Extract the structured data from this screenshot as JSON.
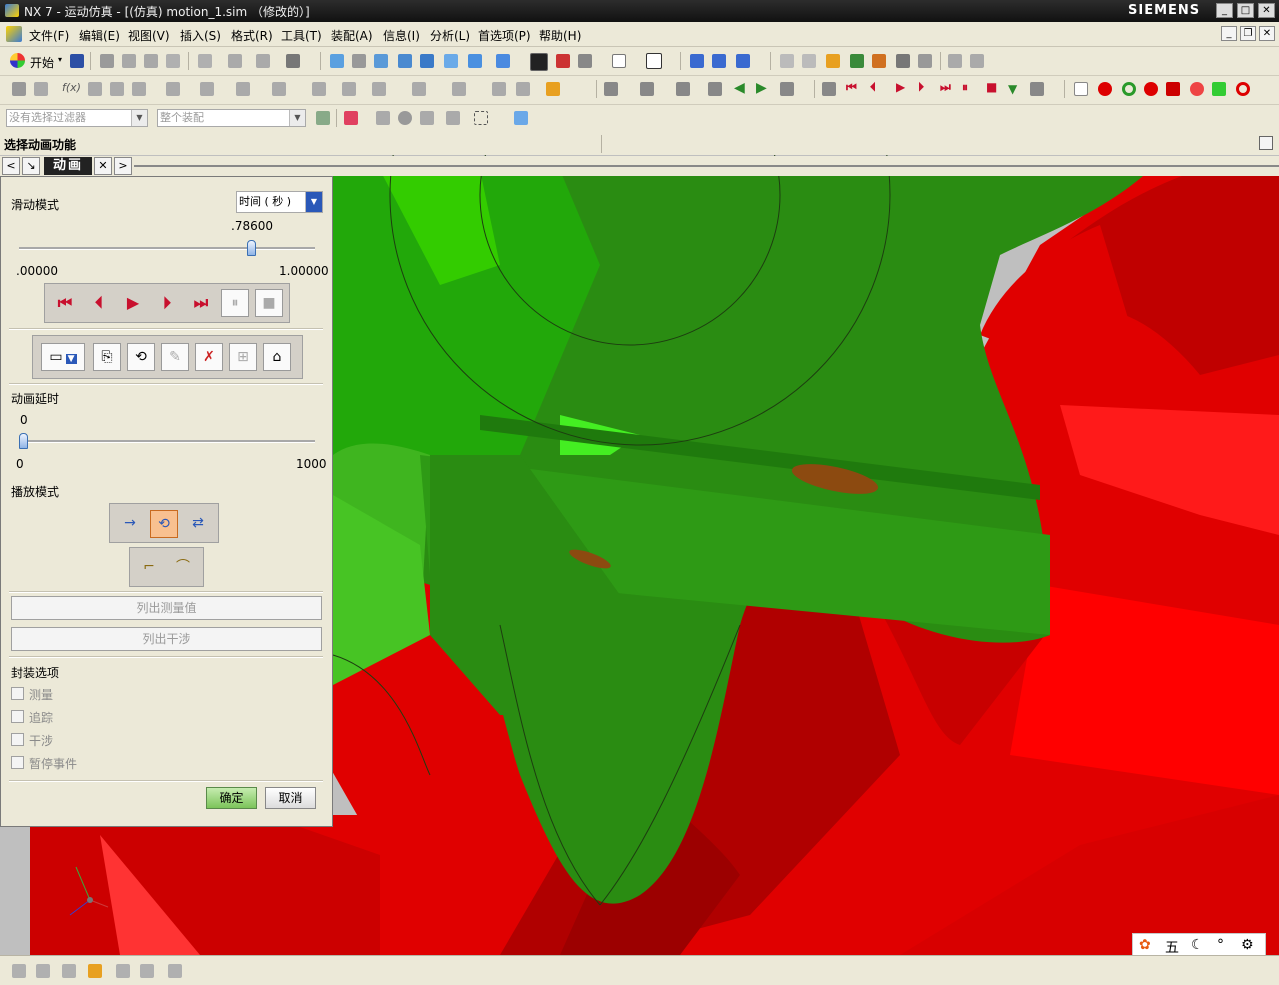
{
  "window": {
    "title": "NX 7 - 运动仿真 - [(仿真) motion_1.sim （修改的）]",
    "brand": "SIEMENS",
    "controls": [
      "_",
      "□",
      "✕"
    ]
  },
  "menubar": {
    "items": [
      "文件(F)",
      "编辑(E)",
      "视图(V)",
      "插入(S)",
      "格式(R)",
      "工具(T)",
      "装配(A)",
      "信息(I)",
      "分析(L)",
      "首选项(P)",
      "帮助(H)"
    ]
  },
  "toolbar": {
    "start_label": "开始",
    "filter_placeholder": "没有选择过滤器",
    "assembly_placeholder": "整个装配"
  },
  "cue_line": {
    "text": "选择动画功能"
  },
  "tabstrip": {
    "active_tab": "动画"
  },
  "dialog": {
    "slide_mode": {
      "label": "滑动模式",
      "selected": "时间 ( 秒 )",
      "value": ".78600",
      "min": ".00000",
      "max": "1.00000",
      "fraction": 0.786
    },
    "delay": {
      "label": "动画延时",
      "value": "0",
      "min": "0",
      "max": "1000",
      "fraction": 0.0
    },
    "play_mode": {
      "label": "播放模式"
    },
    "list_measurements": "列出测量值",
    "list_interference": "列出干涉",
    "envelope": {
      "label": "封装选项",
      "options": [
        "测量",
        "追踪",
        "干涉",
        "暂停事件"
      ]
    },
    "ok": "确定",
    "cancel": "取消"
  },
  "ime": {
    "mode_glyph": "五"
  },
  "colors": {
    "gear_red": "#e00000",
    "gear_dark_red": "#9c0000",
    "gear_green": "#2a8c12",
    "gear_light_green": "#33cc00",
    "viewport_bg": "#bfbfbf",
    "ok_green": "#7cc45a"
  }
}
